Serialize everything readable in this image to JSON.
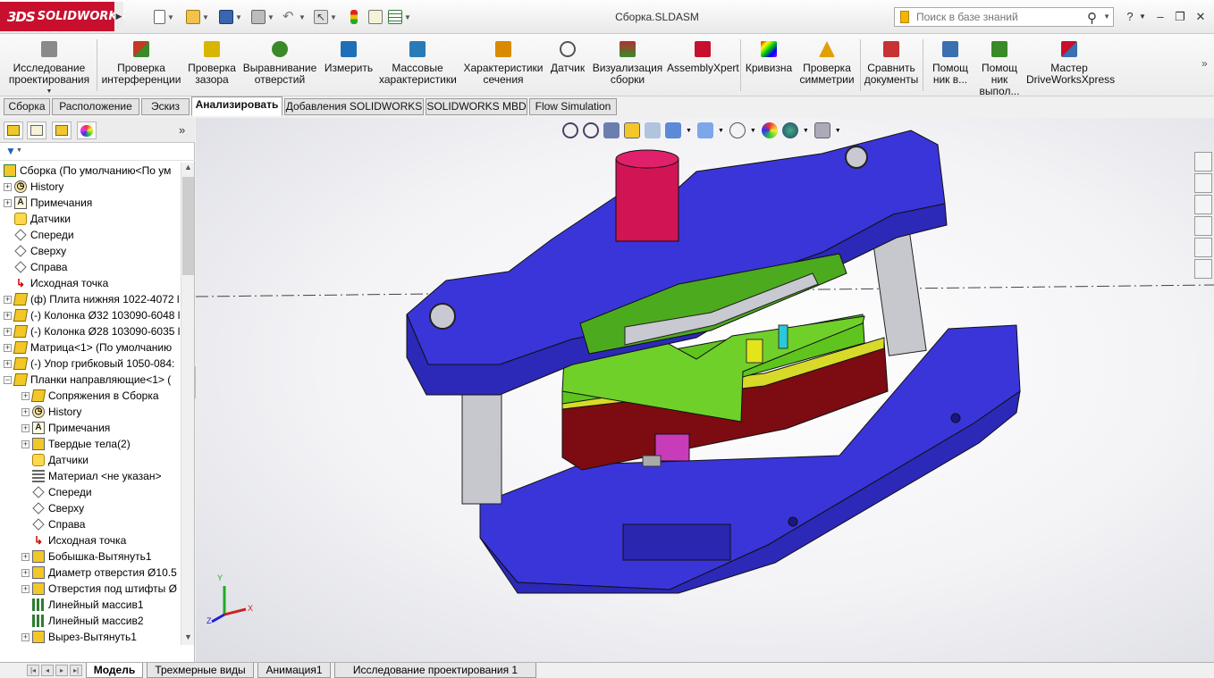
{
  "app": {
    "logo_text": "SOLIDWORKS",
    "logo_mark": "3DS",
    "document_title": "Сборка.SLDASM"
  },
  "search": {
    "placeholder": "Поиск в базе знаний"
  },
  "command_manager": {
    "items": [
      {
        "label": "Исследование проектирования",
        "icon": "design-study-icon",
        "color": "#6b6b6b"
      },
      {
        "label": "Проверка интерференции",
        "icon": "interference-icon",
        "color": "#c23b22"
      },
      {
        "label": "Проверка зазора",
        "icon": "clearance-icon",
        "color": "#c6a600"
      },
      {
        "label": "Выравнивание отверстий",
        "icon": "hole-alignment-icon",
        "color": "#3a8a2a"
      },
      {
        "label": "Измерить",
        "icon": "measure-icon",
        "color": "#1e6fb8"
      },
      {
        "label": "Массовые характеристики",
        "icon": "mass-properties-icon",
        "color": "#2a7ab8"
      },
      {
        "label": "Характеристики сечения",
        "icon": "section-properties-icon",
        "color": "#d98a00"
      },
      {
        "label": "Датчик",
        "icon": "sensor-icon",
        "color": "#555555"
      },
      {
        "label": "Визуализация сборки",
        "icon": "assembly-visualization-icon",
        "color": "#b03030"
      },
      {
        "label": "AssemblyXpert",
        "icon": "assemblyxpert-icon",
        "color": "#c8102e"
      },
      {
        "label": "Кривизна",
        "icon": "curvature-icon",
        "color": "#8a2be2"
      },
      {
        "label": "Проверка симметрии",
        "icon": "symmetry-check-icon",
        "color": "#e0a000"
      },
      {
        "label": "Сравнить документы",
        "icon": "compare-documents-icon",
        "color": "#c83232"
      },
      {
        "label": "Помощ ник в...",
        "icon": "assistant-icon",
        "color": "#3a6fb0"
      },
      {
        "label": "Помощ ник выпол...",
        "icon": "assistant2-icon",
        "color": "#3a8a2a"
      },
      {
        "label": "Мастер DriveWorksXpress",
        "icon": "driveworks-icon",
        "color": "#c8102e"
      }
    ]
  },
  "tabs": [
    {
      "label": "Сборка"
    },
    {
      "label": "Расположение"
    },
    {
      "label": "Эскиз"
    },
    {
      "label": "Анализировать"
    },
    {
      "label": "Добавления SOLIDWORKS"
    },
    {
      "label": "SOLIDWORKS MBD"
    },
    {
      "label": "Flow Simulation"
    }
  ],
  "active_tab": "Анализировать",
  "feature_tree": {
    "root": "Сборка  (По умолчанию<По ум",
    "items": [
      {
        "label": "History",
        "icon": "history-icon",
        "level": 1,
        "expand": "+"
      },
      {
        "label": "Примечания",
        "icon": "annotations-icon",
        "level": 1,
        "expand": "+"
      },
      {
        "label": "Датчики",
        "icon": "sensors-icon",
        "level": 1,
        "expand": ""
      },
      {
        "label": "Спереди",
        "icon": "plane-icon",
        "level": 1,
        "expand": ""
      },
      {
        "label": "Сверху",
        "icon": "plane-icon",
        "level": 1,
        "expand": ""
      },
      {
        "label": "Справа",
        "icon": "plane-icon",
        "level": 1,
        "expand": ""
      },
      {
        "label": "Исходная точка",
        "icon": "origin-icon",
        "level": 1,
        "expand": ""
      },
      {
        "label": "(ф) Плита нижняя 1022-4072 l",
        "icon": "part-icon",
        "level": 1,
        "expand": "+"
      },
      {
        "label": "(-) Колонка Ø32 103090-6048 l",
        "icon": "part-icon",
        "level": 1,
        "expand": "+"
      },
      {
        "label": "(-) Колонка Ø28 103090-6035 l",
        "icon": "part-icon",
        "level": 1,
        "expand": "+"
      },
      {
        "label": "Матрица<1> (По умолчанию",
        "icon": "part-icon",
        "level": 1,
        "expand": "+"
      },
      {
        "label": "(-) Упор грибковый 1050-084:",
        "icon": "part-icon",
        "level": 1,
        "expand": "+"
      },
      {
        "label": "Планки направляющие<1> (",
        "icon": "part-icon",
        "level": 1,
        "expand": "−"
      },
      {
        "label": "Сопряжения в Сборка",
        "icon": "mates-icon",
        "level": 2,
        "expand": "+"
      },
      {
        "label": "History",
        "icon": "history-icon",
        "level": 2,
        "expand": "+"
      },
      {
        "label": "Примечания",
        "icon": "annotations-icon",
        "level": 2,
        "expand": "+"
      },
      {
        "label": "Твердые тела(2)",
        "icon": "solid-bodies-icon",
        "level": 2,
        "expand": "+"
      },
      {
        "label": "Датчики",
        "icon": "sensors-icon",
        "level": 2,
        "expand": ""
      },
      {
        "label": "Материал <не указан>",
        "icon": "material-icon",
        "level": 2,
        "expand": ""
      },
      {
        "label": "Спереди",
        "icon": "plane-icon",
        "level": 2,
        "expand": ""
      },
      {
        "label": "Сверху",
        "icon": "plane-icon",
        "level": 2,
        "expand": ""
      },
      {
        "label": "Справа",
        "icon": "plane-icon",
        "level": 2,
        "expand": ""
      },
      {
        "label": "Исходная точка",
        "icon": "origin-icon",
        "level": 2,
        "expand": ""
      },
      {
        "label": "Бобышка-Вытянуть1",
        "icon": "feature-icon",
        "level": 2,
        "expand": "+"
      },
      {
        "label": "Диаметр отверстия Ø10.5",
        "icon": "feature-icon",
        "level": 2,
        "expand": "+"
      },
      {
        "label": "Отверстия под штифты Ø",
        "icon": "feature-icon",
        "level": 2,
        "expand": "+"
      },
      {
        "label": "Линейный массив1",
        "icon": "pattern-icon",
        "level": 2,
        "expand": ""
      },
      {
        "label": "Линейный массив2",
        "icon": "pattern-icon",
        "level": 2,
        "expand": ""
      },
      {
        "label": "Вырез-Вытянуть1",
        "icon": "feature-icon",
        "level": 2,
        "expand": "+"
      }
    ]
  },
  "triad": {
    "x": "X",
    "y": "Y",
    "z": "Z"
  },
  "bottom_tabs": [
    {
      "label": "Модель"
    },
    {
      "label": "Трехмерные виды"
    },
    {
      "label": "Анимация1"
    },
    {
      "label": "Исследование проектирования 1"
    }
  ],
  "active_bottom_tab": "Модель",
  "colors": {
    "model_blue": "#3a35d9",
    "punch_red": "#d11453",
    "die_green": "#5fc41e",
    "die_darkred": "#7d0b12",
    "pillar_gray": "#c7c8cd",
    "brand_red": "#c8102e"
  }
}
